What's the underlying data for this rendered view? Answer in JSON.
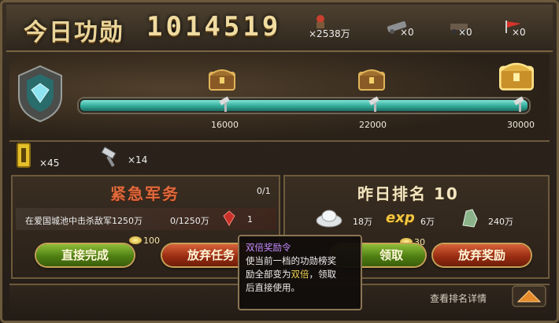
{
  "header": {
    "title": "今日功勋",
    "merit_value": "1014519",
    "stats": [
      {
        "icon": "soldier-icon",
        "text": "×2538万"
      },
      {
        "icon": "cannon-icon",
        "text": "×0"
      },
      {
        "icon": "cart-icon",
        "text": "×0"
      },
      {
        "icon": "flag-icon",
        "text": "×0"
      }
    ]
  },
  "progress": {
    "fill_fraction": 1.0,
    "milestones": [
      {
        "label": "16000"
      },
      {
        "label": "22000"
      },
      {
        "label": "30000"
      }
    ]
  },
  "resources": [
    {
      "icon": "token-icon",
      "text": "×45"
    },
    {
      "icon": "hammer-icon",
      "text": "×14"
    }
  ],
  "mission_panel": {
    "title": "紧急军务",
    "count": "0/1",
    "task_desc": "在爱国城池中击杀敌军1250万",
    "task_progress": "0/1250万",
    "reward_count": "1",
    "coin_cost": "100",
    "complete_button": "直接完成",
    "abandon_button": "放弃任务"
  },
  "rank_panel": {
    "title": "昨日排名 10",
    "rewards": [
      {
        "icon": "silver-icon",
        "text": "18万"
      },
      {
        "icon": "exp-icon",
        "label": "exp",
        "text": "6万"
      },
      {
        "icon": "jade-icon",
        "text": "240万"
      }
    ],
    "coin_cost": "30",
    "claim_button": "领取",
    "abandon_reward_button": "放弃奖励"
  },
  "footer": {
    "view_rank_link": "查看排名详情"
  },
  "tooltip": {
    "title": "双倍奖励令",
    "line1": "使当前一档的功勋榜奖",
    "line2_a": "励全部变为",
    "line2_highlight": "双倍",
    "line2_b": "，领取",
    "line3": "后直接使用。"
  },
  "colors": {
    "accent_gold": "#e9d49a",
    "mission_title": "#e06a3c",
    "rank_title": "#f3e6c0",
    "tooltip_title": "#c48cff",
    "tooltip_highlight": "#f2d350"
  }
}
